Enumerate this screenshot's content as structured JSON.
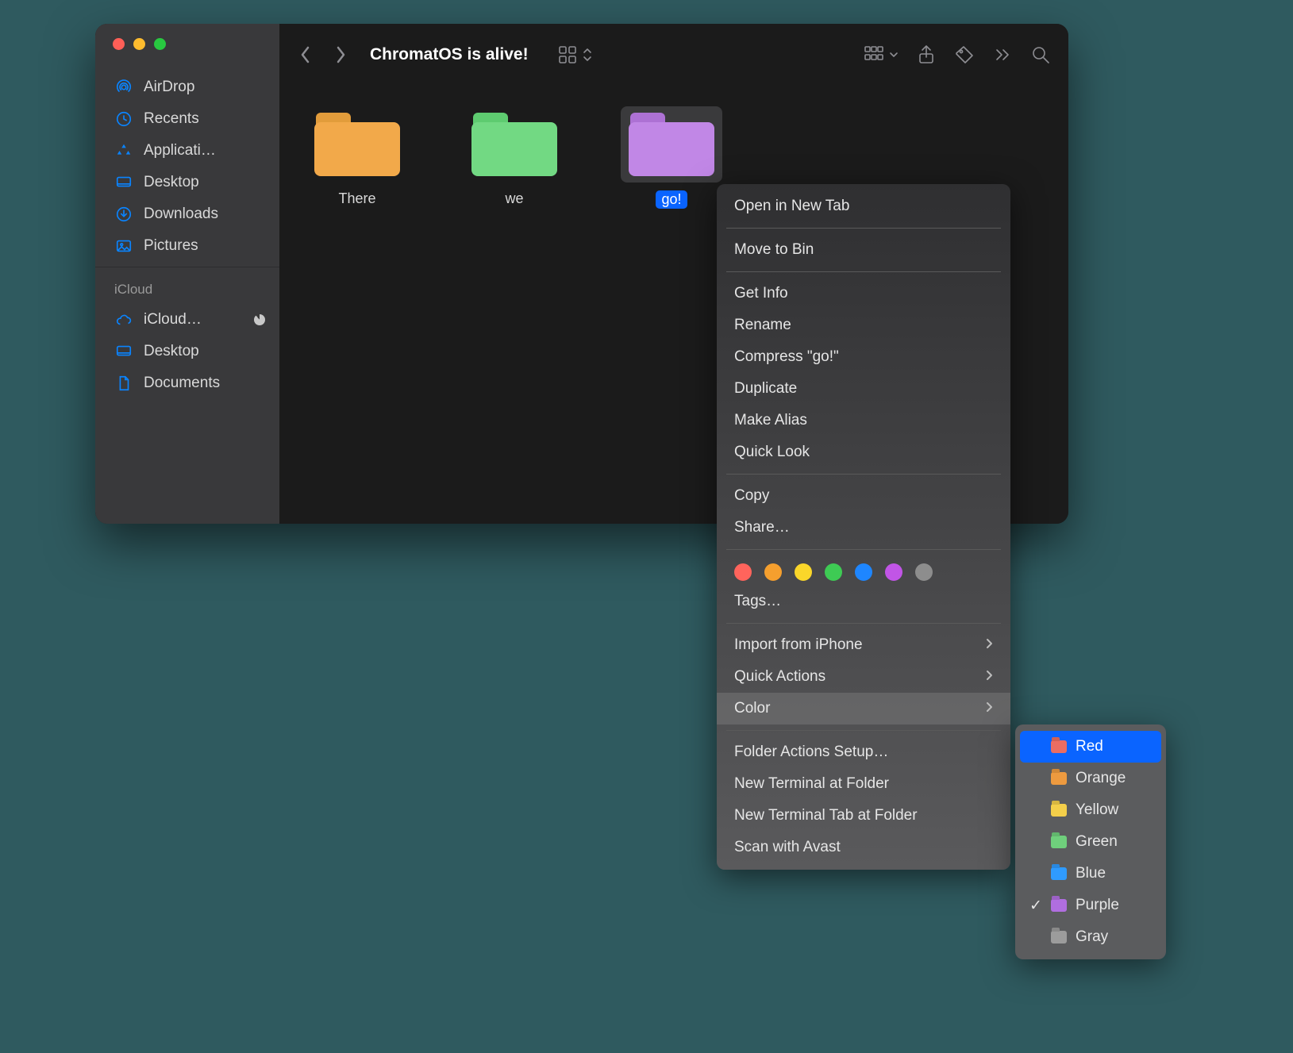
{
  "window": {
    "title": "ChromatOS is alive!"
  },
  "sidebar": {
    "sections": [
      {
        "items": [
          {
            "icon": "airdrop",
            "label": "AirDrop"
          },
          {
            "icon": "clock",
            "label": "Recents"
          },
          {
            "icon": "apps",
            "label": "Applicati…"
          },
          {
            "icon": "desktop",
            "label": "Desktop"
          },
          {
            "icon": "download",
            "label": "Downloads"
          },
          {
            "icon": "picture",
            "label": "Pictures"
          }
        ]
      },
      {
        "heading": "iCloud",
        "items": [
          {
            "icon": "cloud",
            "label": "iCloud…",
            "progress": true
          },
          {
            "icon": "desktop",
            "label": "Desktop"
          },
          {
            "icon": "document",
            "label": "Documents"
          }
        ]
      }
    ]
  },
  "files": [
    {
      "name": "There",
      "color_top": "#e29c3b",
      "color_body": "#f2a94a",
      "selected": false
    },
    {
      "name": "we",
      "color_top": "#5ecb70",
      "color_body": "#72d983",
      "selected": false
    },
    {
      "name": "go!",
      "color_top": "#ad71d4",
      "color_body": "#c187e6",
      "selected": true
    }
  ],
  "context_menu": {
    "groups": [
      [
        {
          "label": "Open in New Tab"
        }
      ],
      [
        {
          "label": "Move to Bin"
        }
      ],
      [
        {
          "label": "Get Info"
        },
        {
          "label": "Rename"
        },
        {
          "label": "Compress \"go!\""
        },
        {
          "label": "Duplicate"
        },
        {
          "label": "Make Alias"
        },
        {
          "label": "Quick Look"
        }
      ],
      [
        {
          "label": "Copy"
        },
        {
          "label": "Share…"
        }
      ]
    ],
    "tag_colors": [
      "#ff645c",
      "#f59f2e",
      "#fad62a",
      "#3ecb54",
      "#1e86ff",
      "#c155e6",
      "#8d8d8d"
    ],
    "tags_label": "Tags…",
    "after_tags": [
      {
        "label": "Import from iPhone",
        "submenu": true
      },
      {
        "label": "Quick Actions",
        "submenu": true
      },
      {
        "label": "Color",
        "submenu": true,
        "highlighted": true
      }
    ],
    "final_group": [
      {
        "label": "Folder Actions Setup…"
      },
      {
        "label": "New Terminal at Folder"
      },
      {
        "label": "New Terminal Tab at Folder"
      },
      {
        "label": "Scan with Avast"
      }
    ]
  },
  "color_submenu": {
    "items": [
      {
        "label": "Red",
        "swatch": "#ea6d62",
        "selected": true,
        "checked": false
      },
      {
        "label": "Orange",
        "swatch": "#ed9a3f",
        "selected": false,
        "checked": false
      },
      {
        "label": "Yellow",
        "swatch": "#f4cf4a",
        "selected": false,
        "checked": false
      },
      {
        "label": "Green",
        "swatch": "#6fcf7c",
        "selected": false,
        "checked": false
      },
      {
        "label": "Blue",
        "swatch": "#2f9bff",
        "selected": false,
        "checked": false
      },
      {
        "label": "Purple",
        "swatch": "#b06ee0",
        "selected": false,
        "checked": true
      },
      {
        "label": "Gray",
        "swatch": "#9c9c9c",
        "selected": false,
        "checked": false
      }
    ]
  }
}
